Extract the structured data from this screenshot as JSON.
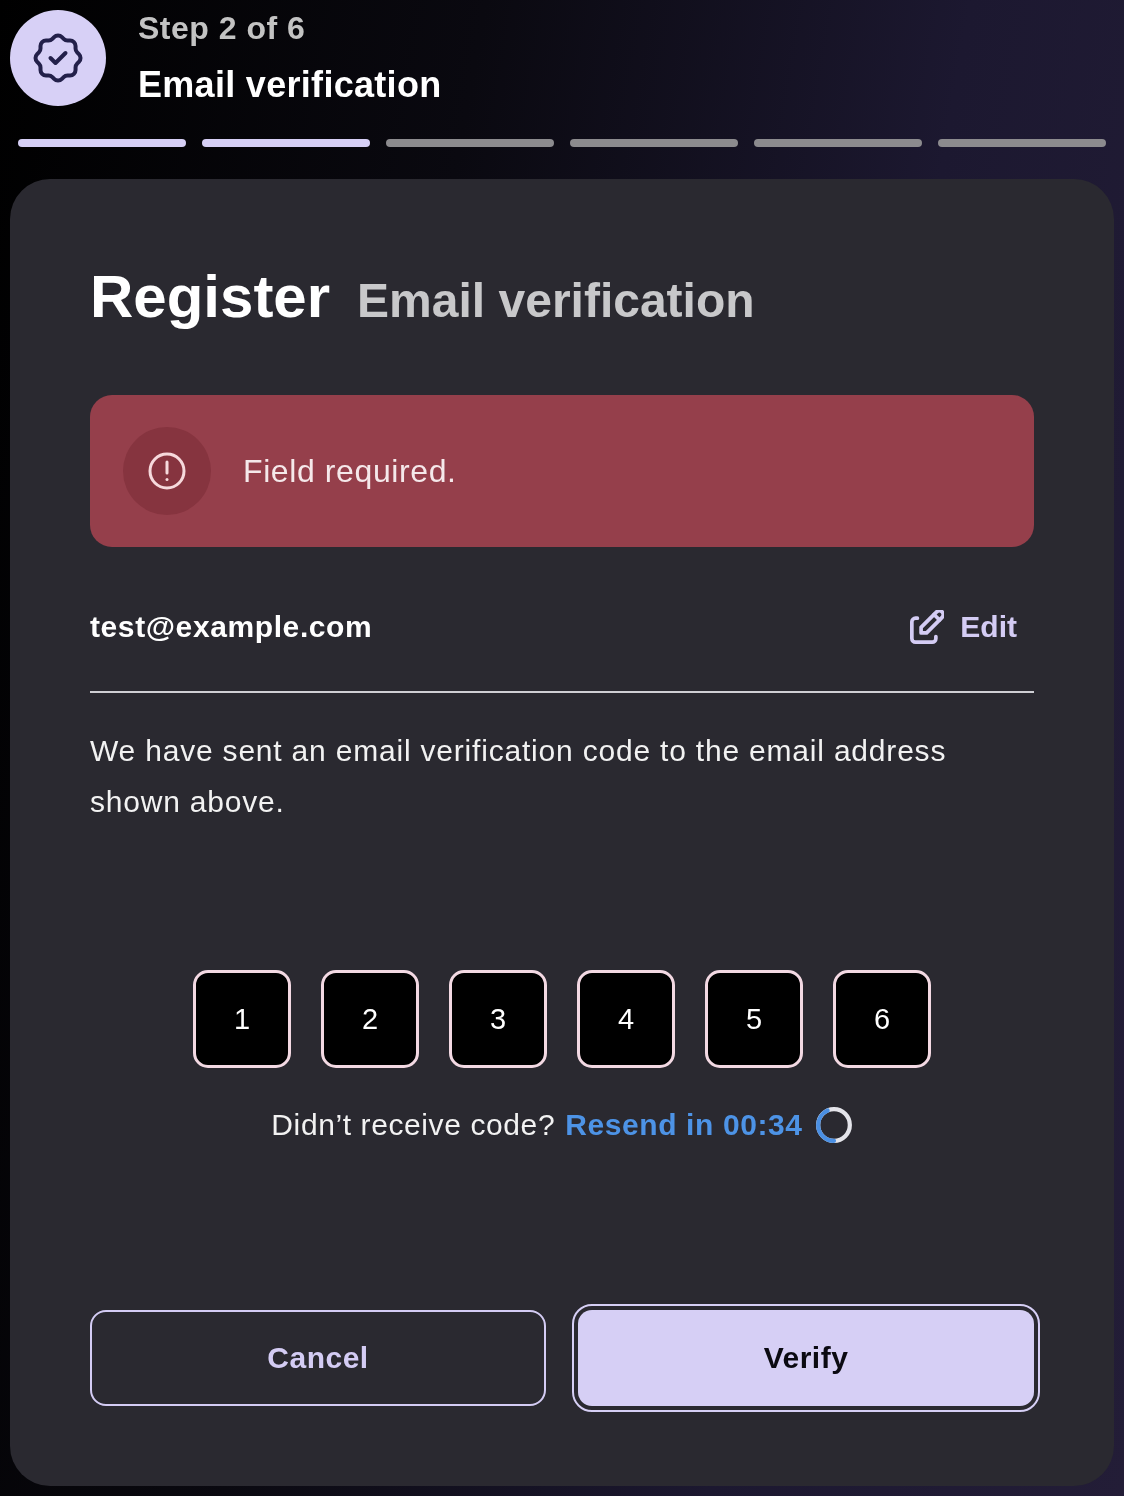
{
  "header": {
    "step": "Step 2 of 6",
    "title": "Email verification"
  },
  "progress": [
    {
      "done": true
    },
    {
      "done": true
    },
    {
      "done": false
    },
    {
      "done": false
    },
    {
      "done": false
    },
    {
      "done": false
    }
  ],
  "card": {
    "title": "Register",
    "subtitle": "Email verification"
  },
  "alert": {
    "kind": "error",
    "message": "Field required."
  },
  "email": {
    "address": "test@example.com",
    "edit_label": "Edit"
  },
  "instructions": "We have sent an email verification code to the email address shown above.",
  "code_boxes": [
    "1",
    "2",
    "3",
    "4",
    "5",
    "6"
  ],
  "resend": {
    "prompt": "Didn’t receive code?",
    "link": "Resend in 00:34",
    "loading": true
  },
  "buttons": [
    {
      "label": "Cancel",
      "kind": "secondary",
      "focused": false
    },
    {
      "label": "Verify",
      "kind": "primary",
      "focused": true
    }
  ]
}
